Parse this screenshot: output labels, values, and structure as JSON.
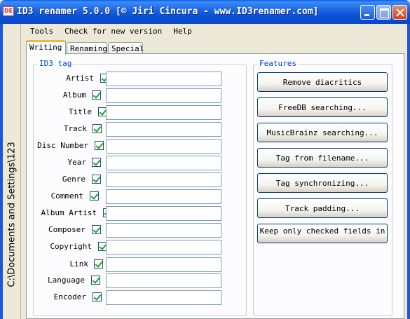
{
  "window": {
    "title": "ID3 renamer 5.0.0 [© Jiri Cincura - www.ID3renamer.com]",
    "icon_text": "DE"
  },
  "sidebar": {
    "path": "C:\\Documents and Settings\\123"
  },
  "menu": [
    "Tools",
    "Check for new version",
    "Help"
  ],
  "tabs": [
    {
      "label": "Writing",
      "active": true
    },
    {
      "label": "Renaming",
      "active": false
    },
    {
      "label": "Special",
      "active": false
    }
  ],
  "id3_tag": {
    "title": "ID3 tag",
    "fields": [
      {
        "label": "Artist",
        "checked": true,
        "value": ""
      },
      {
        "label": "Album",
        "checked": true,
        "value": ""
      },
      {
        "label": "Title",
        "checked": true,
        "value": ""
      },
      {
        "label": "Track",
        "checked": true,
        "value": ""
      },
      {
        "label": "Disc Number",
        "checked": true,
        "value": ""
      },
      {
        "label": "Year",
        "checked": true,
        "value": ""
      },
      {
        "label": "Genre",
        "checked": true,
        "value": ""
      },
      {
        "label": "Comment",
        "checked": true,
        "value": ""
      },
      {
        "label": "Album Artist",
        "checked": true,
        "value": ""
      },
      {
        "label": "Composer",
        "checked": true,
        "value": ""
      },
      {
        "label": "Copyright",
        "checked": true,
        "value": ""
      },
      {
        "label": "Link",
        "checked": true,
        "value": ""
      },
      {
        "label": "Language",
        "checked": true,
        "value": ""
      },
      {
        "label": "Encoder",
        "checked": true,
        "value": ""
      }
    ]
  },
  "features": {
    "title": "Features",
    "buttons": [
      "Remove diacritics",
      "FreeDB searching...",
      "MusicBrainz searching...",
      "Tag from filename...",
      "Tag synchronizing...",
      "Track padding...",
      "Keep only checked fields in"
    ]
  }
}
